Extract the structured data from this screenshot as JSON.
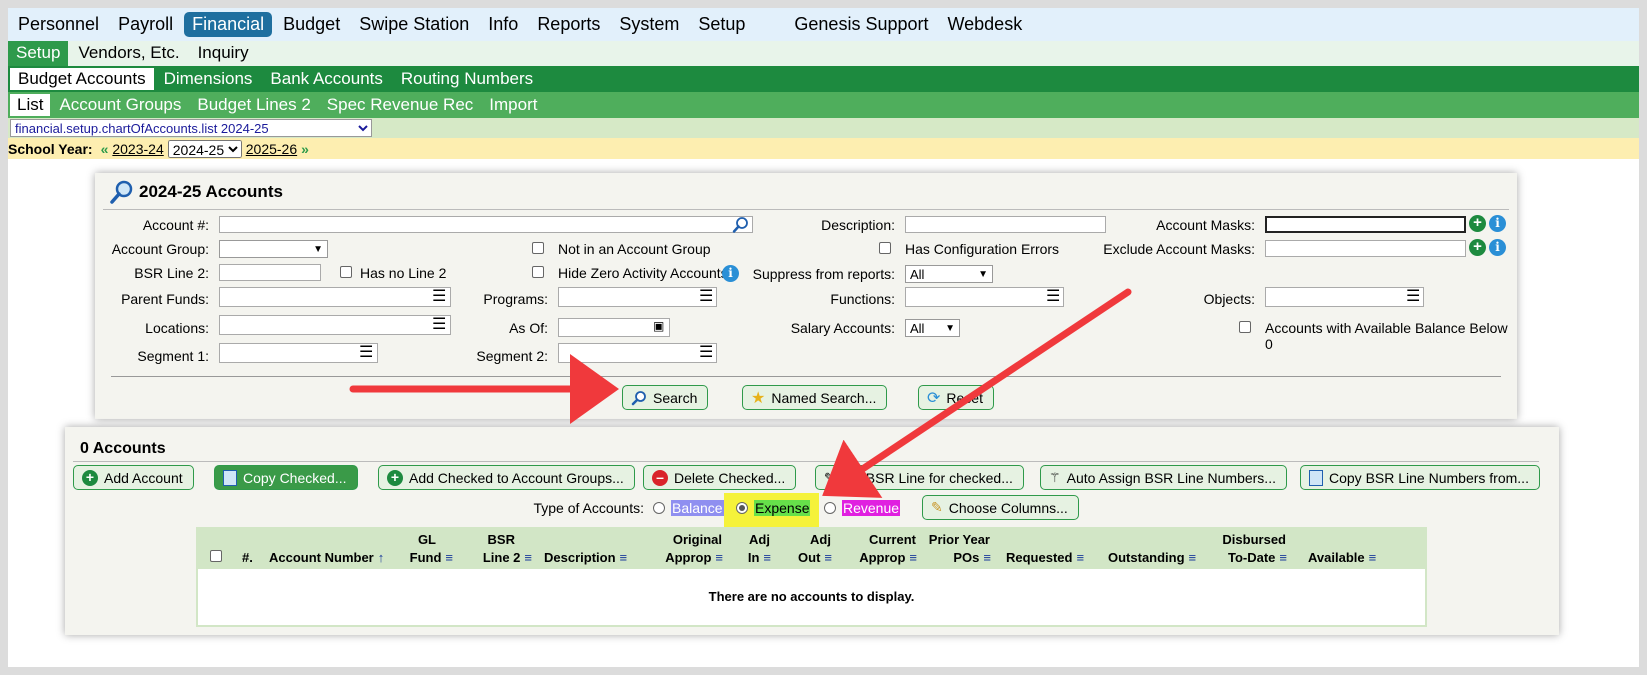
{
  "top_menu": [
    "Personnel",
    "Payroll",
    "Financial",
    "Budget",
    "Swipe Station",
    "Info",
    "Reports",
    "System",
    "Setup",
    "Genesis Support",
    "Webdesk"
  ],
  "sub_menu_1": [
    "Setup",
    "Vendors, Etc.",
    "Inquiry"
  ],
  "sub_menu_2": [
    "Budget Accounts",
    "Dimensions",
    "Bank Accounts",
    "Routing Numbers"
  ],
  "sub_menu_3": [
    "List",
    "Account Groups",
    "Budget Lines 2",
    "Spec Revenue Rec",
    "Import"
  ],
  "page_select": "financial.setup.chartOfAccounts.list 2024-25",
  "school_year": {
    "label": "School Year:",
    "prev": "2023-24",
    "current": "2024-25",
    "next": "2025-26"
  },
  "search_panel": {
    "title": "2024-25 Accounts",
    "account_num_label": "Account #:",
    "account_group_label": "Account Group:",
    "bsr_line2_label": "BSR Line 2:",
    "has_no_line2": "Has no Line 2",
    "parent_funds_label": "Parent Funds:",
    "locations_label": "Locations:",
    "segment1_label": "Segment 1:",
    "not_in_group": "Not in an Account Group",
    "hide_zero": "Hide Zero Activity Accounts",
    "programs_label": "Programs:",
    "as_of_label": "As Of:",
    "segment2_label": "Segment 2:",
    "description_label": "Description:",
    "has_config_errors": "Has Configuration Errors",
    "suppress_label": "Suppress from reports:",
    "suppress_value": "All",
    "functions_label": "Functions:",
    "salary_label": "Salary Accounts:",
    "salary_value": "All",
    "account_masks_label": "Account Masks:",
    "exclude_masks_label": "Exclude Account Masks:",
    "objects_label": "Objects:",
    "below_zero": "Accounts with Available Balance Below 0",
    "search_btn": "Search",
    "named_search_btn": "Named Search...",
    "reset_btn": "Reset"
  },
  "results_panel": {
    "title": "0 Accounts",
    "add_account": "Add Account",
    "copy_checked": "Copy Checked...",
    "add_to_groups": "Add Checked to Account Groups...",
    "delete_checked": "Delete Checked...",
    "set_bsr": "Set BSR Line for checked...",
    "auto_assign": "Auto Assign BSR Line Numbers...",
    "copy_bsr": "Copy BSR Line Numbers from...",
    "type_label": "Type of Accounts:",
    "types": [
      "Balance",
      "Expense",
      "Revenue"
    ],
    "selected_type": "Expense",
    "choose_columns": "Choose Columns...",
    "columns": {
      "num": "#.",
      "account_number": "Account Number",
      "gl": "GL",
      "fund": "Fund",
      "bsr": "BSR",
      "line2": "Line 2",
      "description": "Description",
      "original": "Original",
      "approp": "Approp",
      "adj1": "Adj",
      "in": "In",
      "adj2": "Adj",
      "out": "Out",
      "current": "Current",
      "current_approp": "Approp",
      "prior_year": "Prior Year",
      "pos": "POs",
      "requested": "Requested",
      "outstanding": "Outstanding",
      "disbursed": "Disbursed",
      "to_date": "To-Date",
      "available": "Available"
    },
    "empty_message": "There are no accounts to display."
  },
  "colors": {
    "balance": "#8f8ff0",
    "expense": "#66e04a",
    "revenue": "#e020e0",
    "highlight": "#f5f23a",
    "arrow": "#f0393c"
  }
}
